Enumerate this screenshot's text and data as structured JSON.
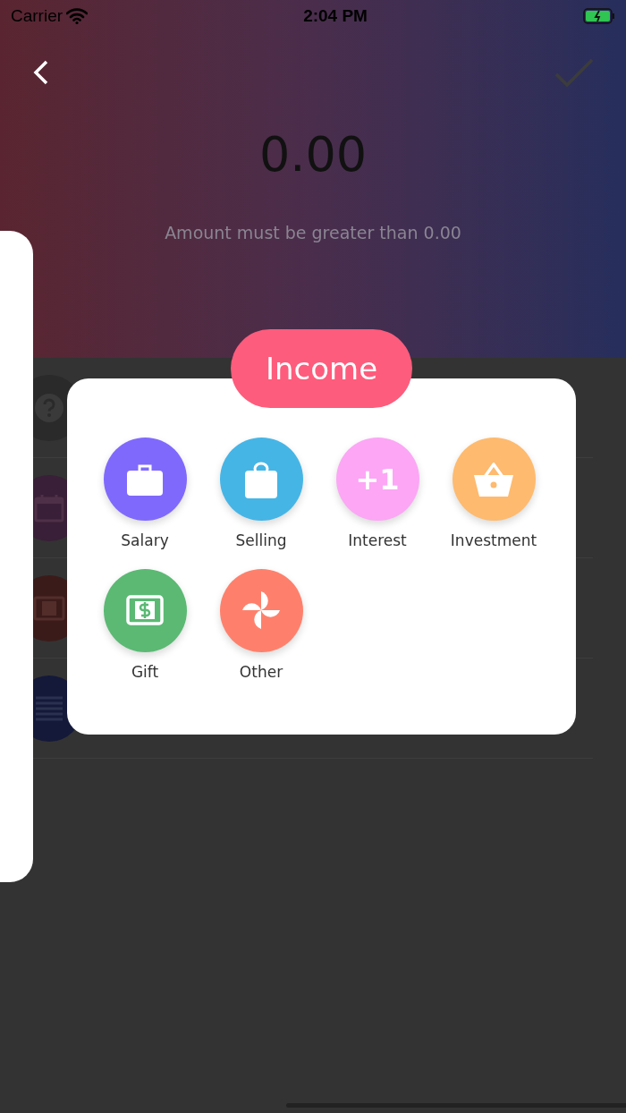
{
  "status_bar": {
    "carrier": "Carrier",
    "time": "2:04 PM"
  },
  "header": {
    "amount": "0.00",
    "hint": "Amount must be greater than 0.00"
  },
  "popup": {
    "title": "Income",
    "categories": [
      {
        "label": "Salary",
        "kind": "briefcase",
        "color": "#7f69fd"
      },
      {
        "label": "Selling",
        "kind": "bag",
        "color": "#45b5e6"
      },
      {
        "label": "Interest",
        "kind": "glyph",
        "glyph": "+1",
        "color": "#fca6f5"
      },
      {
        "label": "Investment",
        "kind": "basket",
        "color": "#feba6e"
      },
      {
        "label": "Gift",
        "kind": "bill",
        "color": "#5bb974"
      },
      {
        "label": "Other",
        "kind": "pinwheel",
        "color": "#fe806c"
      }
    ]
  }
}
